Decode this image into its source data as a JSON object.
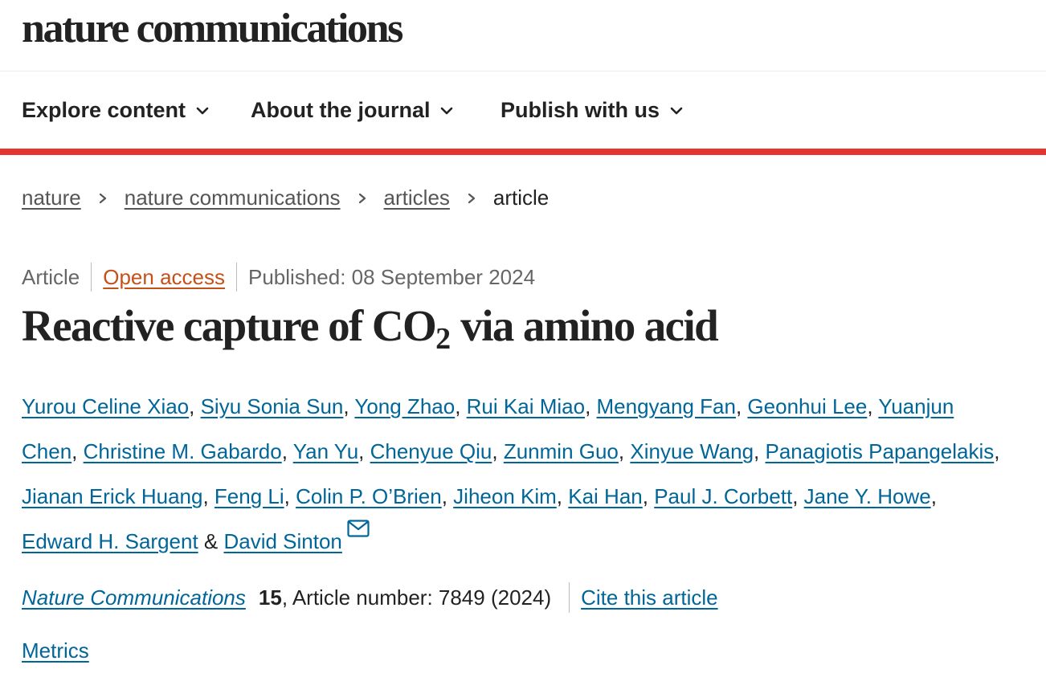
{
  "site": {
    "logo": "nature communications"
  },
  "nav": {
    "items": [
      {
        "label": "Explore content",
        "icon": "chevron-down-icon"
      },
      {
        "label": "About the journal",
        "icon": "chevron-down-icon"
      },
      {
        "label": "Publish with us",
        "icon": "chevron-down-icon"
      }
    ]
  },
  "breadcrumb": {
    "items": [
      "nature",
      "nature communications",
      "articles"
    ],
    "current": "article",
    "separator_icon": "chevron-right-icon"
  },
  "article": {
    "type": "Article",
    "access": "Open access",
    "published": "Published: 08 September 2024",
    "title": {
      "before": "Reactive capture of CO",
      "subscript": "2",
      "after": " via amino acid"
    },
    "authors": [
      "Yurou Celine Xiao",
      "Siyu Sonia Sun",
      "Yong Zhao",
      "Rui Kai Miao",
      "Mengyang Fan",
      "Geonhui Lee",
      "Yuanjun Chen",
      "Christine M. Gabardo",
      "Yan Yu",
      "Chenyue Qiu",
      "Zunmin Guo",
      "Xinyue Wang",
      "Panagiotis Papangelakis",
      "Jianan Erick Huang",
      "Feng Li",
      "Colin P. O’Brien",
      "Jiheon Kim",
      "Kai Han",
      "Paul J. Corbett",
      "Jane Y. Howe",
      "Edward H. Sargent",
      "David Sinton"
    ],
    "author_separator": ", ",
    "last_author_joiner": " & ",
    "corresponding_icon": "mail-icon",
    "journal": "Nature Communications",
    "volume": "15",
    "article_number": ", Article number: 7849 (2024)",
    "cite_label": "Cite this article",
    "metrics_label": "Metrics"
  },
  "colors": {
    "accent_red": "#e5352f",
    "link": "#006699",
    "open_access": "#c4501a",
    "text": "#222222"
  }
}
